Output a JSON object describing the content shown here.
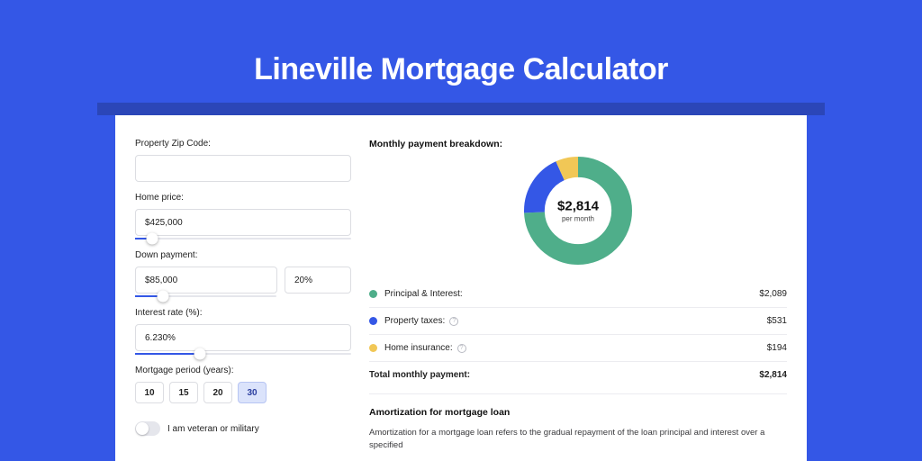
{
  "title": "Lineville Mortgage Calculator",
  "form": {
    "zip_label": "Property Zip Code:",
    "zip_value": "",
    "home_price_label": "Home price:",
    "home_price_value": "$425,000",
    "home_price_slider_pct": 8,
    "down_payment_label": "Down payment:",
    "down_payment_value": "$85,000",
    "down_payment_pct_value": "20%",
    "down_payment_slider_pct": 20,
    "interest_label": "Interest rate (%):",
    "interest_value": "6.230%",
    "interest_slider_pct": 30,
    "period_label": "Mortgage period (years):",
    "periods": [
      "10",
      "15",
      "20",
      "30"
    ],
    "period_selected": "30",
    "veteran_label": "I am veteran or military",
    "veteran_on": false
  },
  "breakdown": {
    "title": "Monthly payment breakdown:",
    "total_amount": "$2,814",
    "total_sub": "per month",
    "items": [
      {
        "label": "Principal & Interest:",
        "value": "$2,089",
        "color": "#4fae8a",
        "info": false
      },
      {
        "label": "Property taxes:",
        "value": "$531",
        "color": "#3457e6",
        "info": true
      },
      {
        "label": "Home insurance:",
        "value": "$194",
        "color": "#f1c756",
        "info": true
      }
    ],
    "total_label": "Total monthly payment:",
    "total_value": "$2,814"
  },
  "amortization": {
    "title": "Amortization for mortgage loan",
    "body": "Amortization for a mortgage loan refers to the gradual repayment of the loan principal and interest over a specified"
  },
  "chart_data": {
    "type": "pie",
    "title": "Monthly payment breakdown",
    "series": [
      {
        "name": "Principal & Interest",
        "value": 2089,
        "color": "#4fae8a"
      },
      {
        "name": "Property taxes",
        "value": 531,
        "color": "#3457e6"
      },
      {
        "name": "Home insurance",
        "value": 194,
        "color": "#f1c756"
      }
    ],
    "total": 2814,
    "center_label": "$2,814",
    "center_sublabel": "per month",
    "donut_inner_ratio": 0.62
  }
}
